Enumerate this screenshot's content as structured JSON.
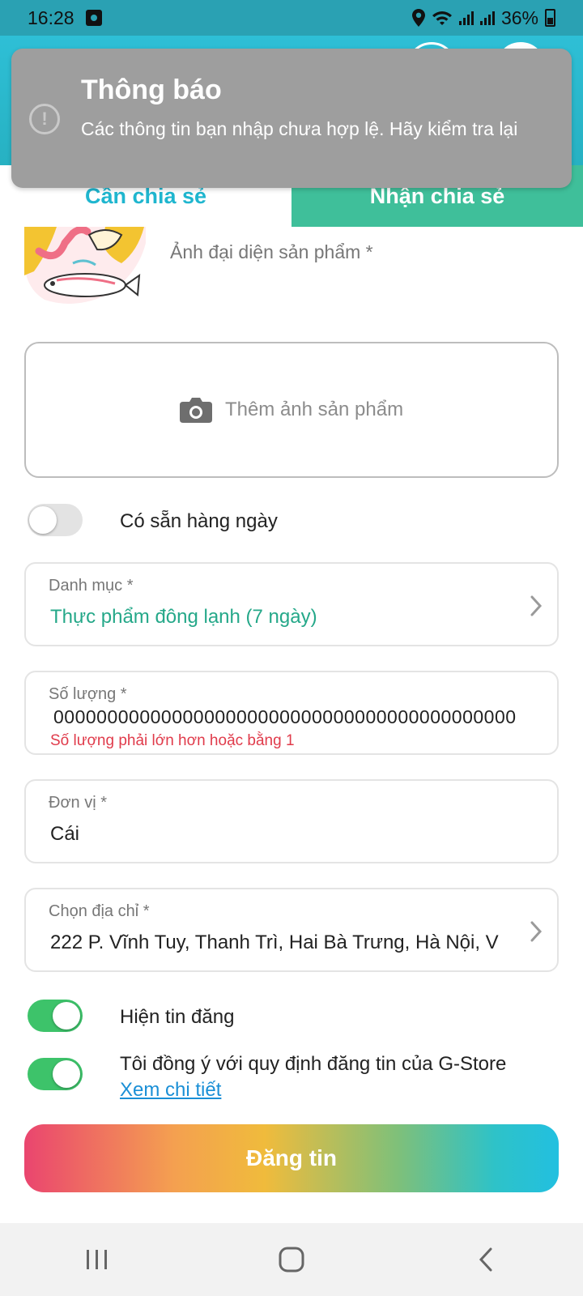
{
  "status_bar": {
    "time": "16:28",
    "battery_percent": "36%"
  },
  "tabs": {
    "need_share": "Cần chia sẻ",
    "receive_share": "Nhận chia sẻ"
  },
  "toast": {
    "title": "Thông báo",
    "message": "Các thông tin bạn nhập chưa hợp lệ. Hãy kiểm tra lại",
    "icon": "alert-circle-icon"
  },
  "product_image": {
    "label": "Ảnh đại diện sản phẩm *",
    "add_photo_text": "Thêm ảnh sản phẩm"
  },
  "available_daily": {
    "label": "Có sẵn hàng ngày",
    "on": false
  },
  "category": {
    "label": "Danh mục *",
    "value": "Thực phẩm đông lạnh (7 ngày)"
  },
  "quantity": {
    "label": "Số lượng *",
    "value": "0000000000000000000000000000000000000000000",
    "error": "Số lượng phải lớn hơn hoặc bằng 1"
  },
  "unit": {
    "label": "Đơn vị *",
    "value": "Cái"
  },
  "address": {
    "label": "Chọn địa chỉ *",
    "value": "222 P. Vĩnh Tuy, Thanh Trì, Hai Bà Trưng, Hà Nội, V"
  },
  "show_post": {
    "label": "Hiện tin đăng",
    "on": true
  },
  "agree": {
    "label": "Tôi đồng ý với quy định đăng tin của G-Store",
    "link": "Xem chi tiết",
    "on": true
  },
  "submit_label": "Đăng tin",
  "colors": {
    "teal": "#2ebfd6",
    "green_tab": "#3fbf9a",
    "switch_on": "#3dc36a",
    "error": "#e03b4b",
    "link": "#1a8fd6"
  }
}
